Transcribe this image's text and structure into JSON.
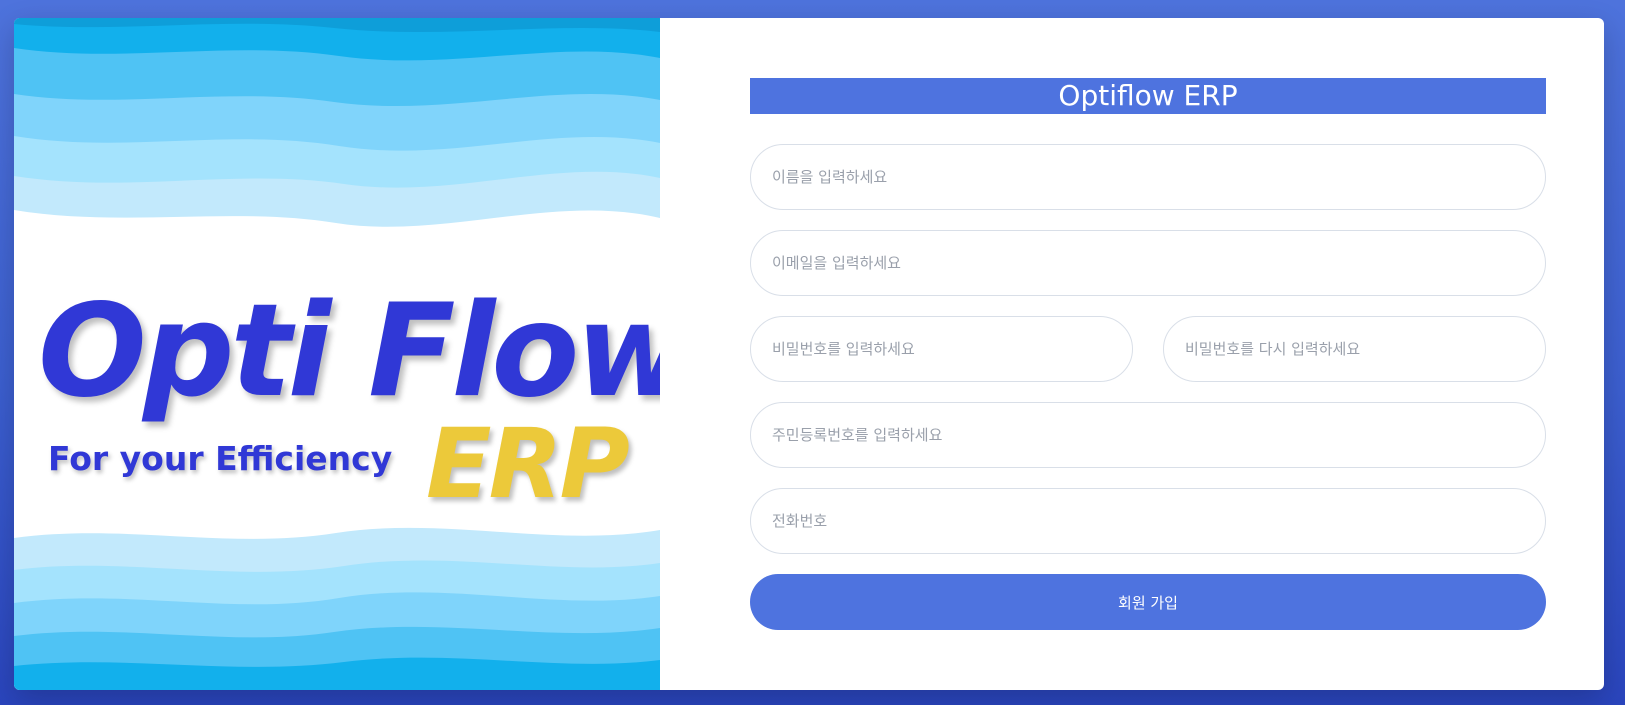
{
  "hero": {
    "brand_main": "Opti Flow",
    "brand_tagline": "For your Efficiency",
    "brand_suffix": "ERP"
  },
  "form": {
    "title": "Optiflow ERP",
    "name_placeholder": "이름을 입력하세요",
    "email_placeholder": "이메일을 입력하세요",
    "password_placeholder": "비밀번호를 입력하세요",
    "password_confirm_placeholder": "비밀번호를 다시 입력하세요",
    "rrn_placeholder": "주민등록번호를 입력하세요",
    "phone_placeholder": "전화번호",
    "submit_label": "회원 가입"
  },
  "colors": {
    "background": "#4e73df",
    "primary": "#4e73df",
    "logo_blue": "#3038d6",
    "logo_yellow": "#ecc93a",
    "wave_light": "#c2e9fc",
    "wave_mid": "#7fd4fb",
    "wave_dark": "#12b0ec"
  }
}
